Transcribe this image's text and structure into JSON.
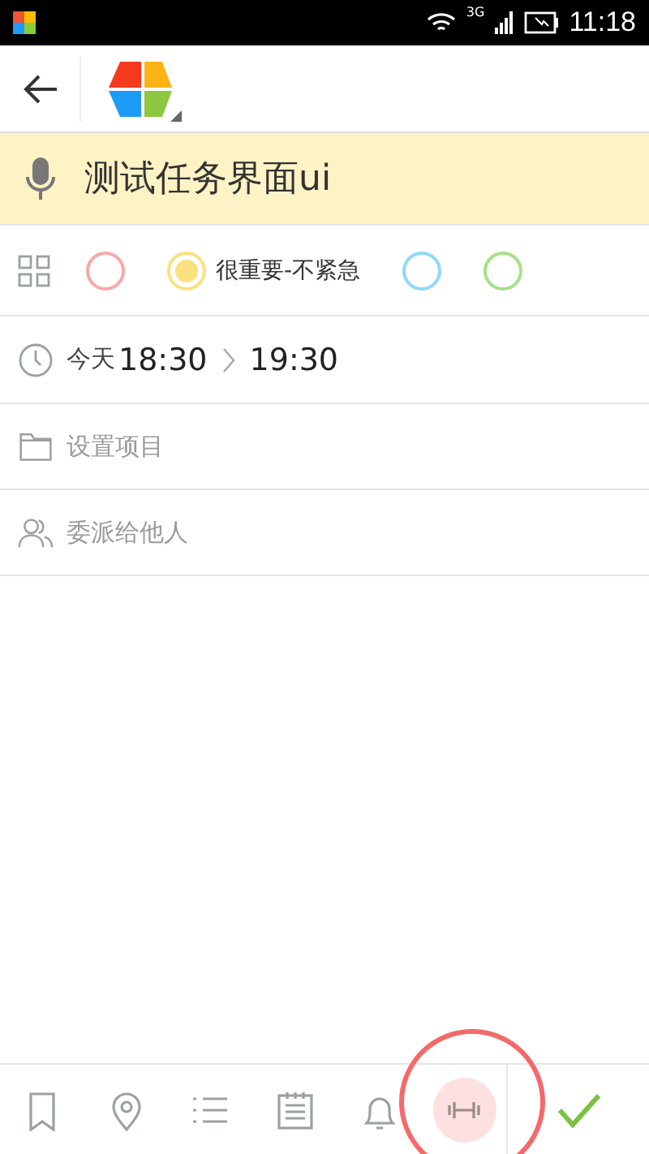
{
  "status_bar": {
    "network": "3G",
    "time": "11:18"
  },
  "task": {
    "title": "测试任务界面ui"
  },
  "priorities": [
    {
      "color": "#f8a8a8",
      "selected": false
    },
    {
      "color": "#fbe07f",
      "selected": true,
      "label": "很重要-不紧急"
    },
    {
      "color": "#8fd8fb",
      "selected": false
    },
    {
      "color": "#a5e08a",
      "selected": false
    }
  ],
  "time": {
    "day": "今天",
    "start": "18:30",
    "end": "19:30"
  },
  "fields": [
    {
      "kind": "project",
      "placeholder": "设置项目"
    },
    {
      "kind": "delegate",
      "placeholder": "委派给他人"
    }
  ],
  "toolbar": [
    {
      "kind": "bookmark",
      "selected": false
    },
    {
      "kind": "location",
      "selected": false
    },
    {
      "kind": "list",
      "selected": false
    },
    {
      "kind": "notes",
      "selected": false
    },
    {
      "kind": "bell",
      "selected": false
    },
    {
      "kind": "dumbbell",
      "selected": true
    }
  ]
}
